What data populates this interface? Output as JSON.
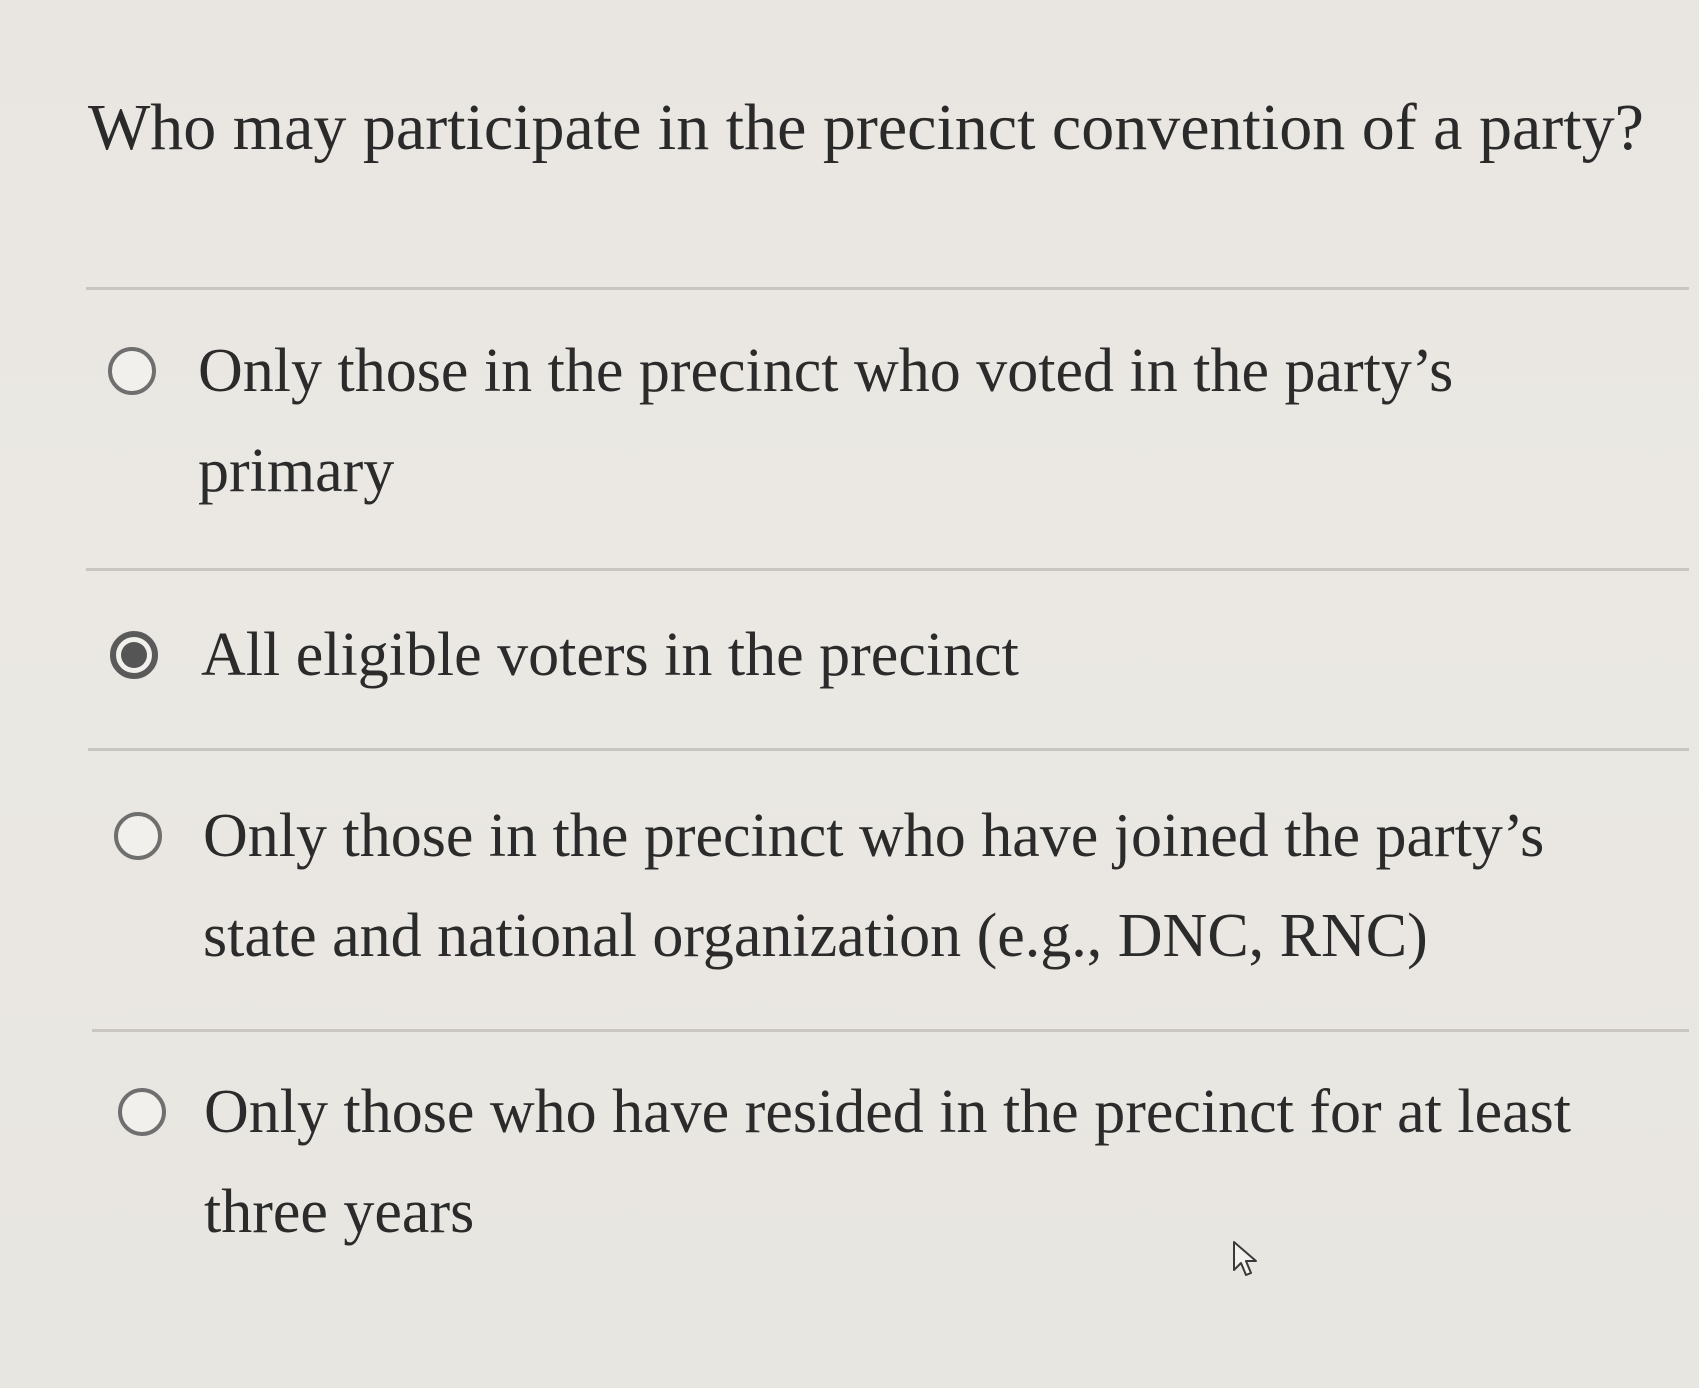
{
  "question": {
    "text": "Who may participate in the precinct convention of a party?"
  },
  "options": [
    {
      "label": "Only those in the precinct who voted in the party’s primary",
      "selected": false
    },
    {
      "label": "All eligible voters in the precinct",
      "selected": true
    },
    {
      "label": "Only those in the precinct who have joined the party’s state and national organization (e.g., DNC, RNC)",
      "selected": false
    },
    {
      "label": "Only those who have resided in the precinct for at least three years",
      "selected": false
    }
  ],
  "icons": {
    "radio": "radio-button-icon",
    "cursor": "mouse-pointer-icon"
  },
  "colors": {
    "background": "#e9e6e1",
    "text": "#2b2b2b",
    "divider": "#c9c6c1",
    "radio_border": "#6f6f6f",
    "radio_fill": "#555555"
  }
}
